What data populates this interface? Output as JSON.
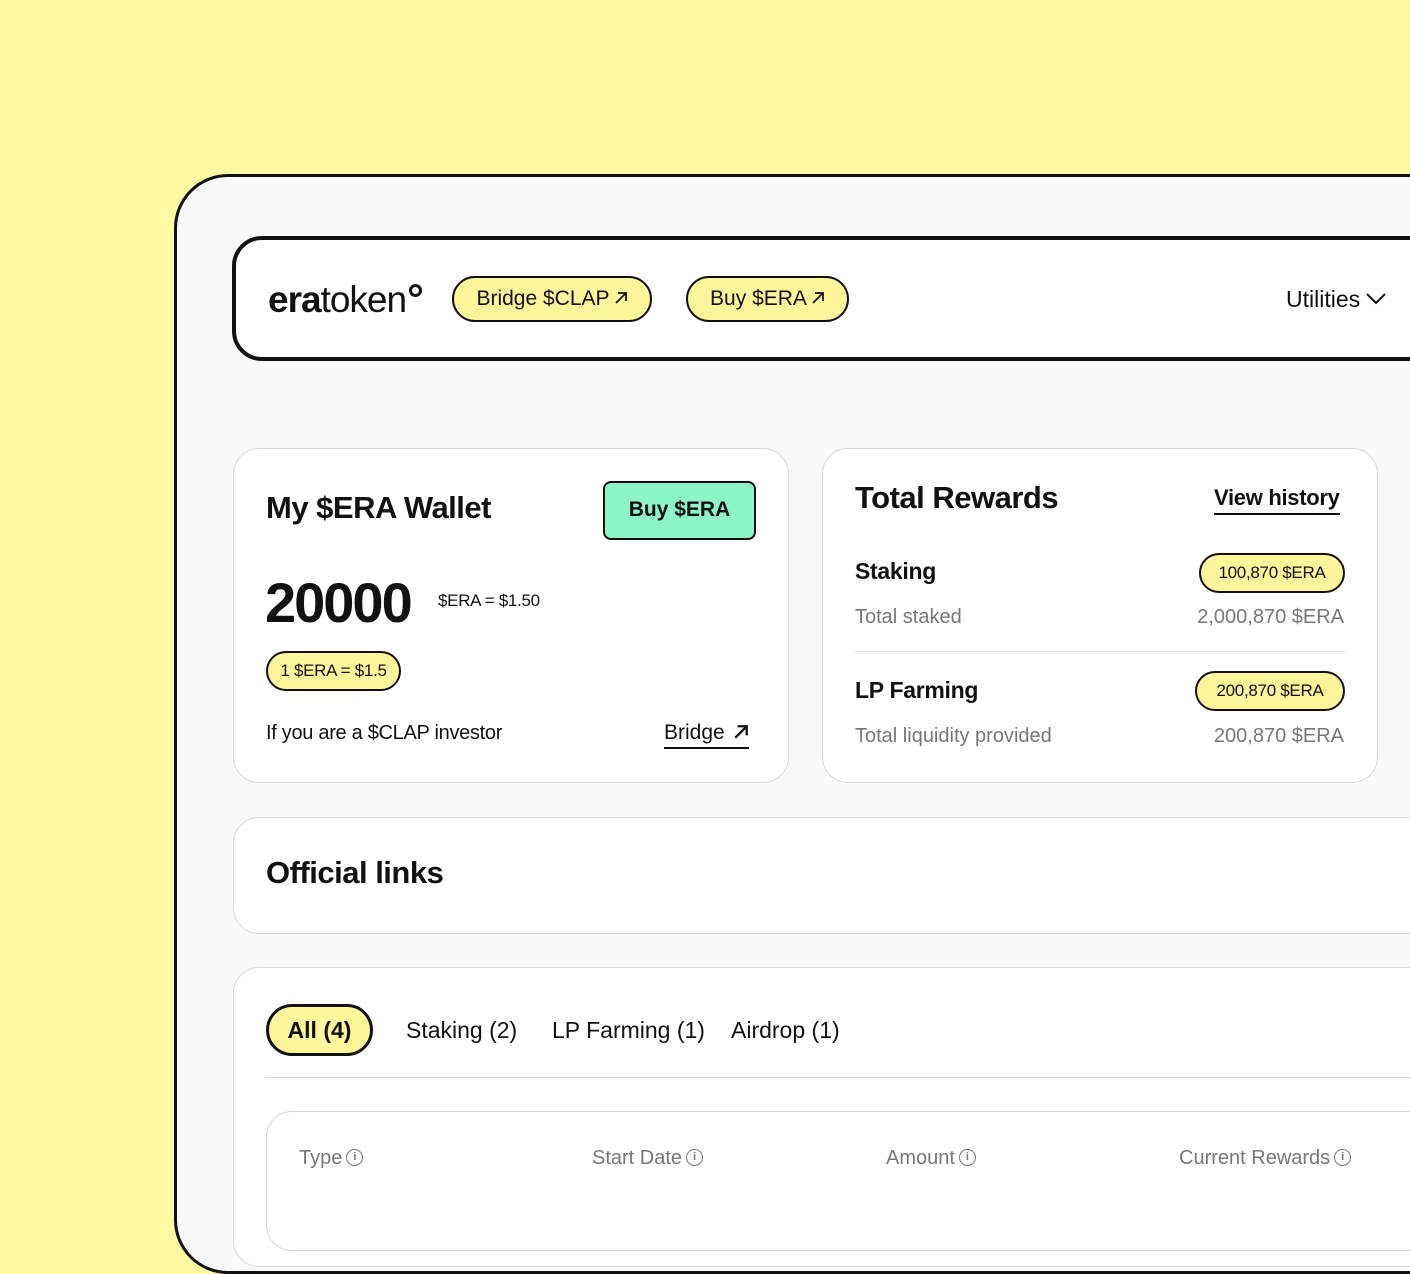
{
  "header": {
    "logo_bold": "era",
    "logo_light": "token",
    "bridge_label": "Bridge $CLAP",
    "buy_label": "Buy $ERA",
    "utilities_label": "Utilities"
  },
  "wallet": {
    "title": "My $ERA Wallet",
    "buy_button": "Buy $ERA",
    "balance": "20000",
    "balance_note": "$ERA = $1.50",
    "rate_pill": "1 $ERA = $1.5",
    "investor_text": "If you are a $CLAP investor",
    "bridge_link": "Bridge"
  },
  "rewards": {
    "title": "Total Rewards",
    "view_history": "View history",
    "staking_label": "Staking",
    "staking_value": "100,870 $ERA",
    "total_staked_label": "Total staked",
    "total_staked_value": "2,000,870 $ERA",
    "lp_label": "LP Farming",
    "lp_value": "200,870 $ERA",
    "liquidity_label": "Total liquidity provided",
    "liquidity_value": "200,870 $ERA"
  },
  "official_links": {
    "title": "Official links"
  },
  "tabs": [
    {
      "label": "All (4)",
      "active": true
    },
    {
      "label": "Staking (2)"
    },
    {
      "label": "LP Farming (1)"
    },
    {
      "label": "Airdrop (1)"
    }
  ],
  "table": {
    "columns": [
      "Type",
      "Start Date",
      "Amount",
      "Current Rewards"
    ]
  },
  "colors": {
    "background": "#FFFAA3",
    "pill": "#FFF59A",
    "buy_button": "#8EF5C8",
    "border": "#111111"
  }
}
